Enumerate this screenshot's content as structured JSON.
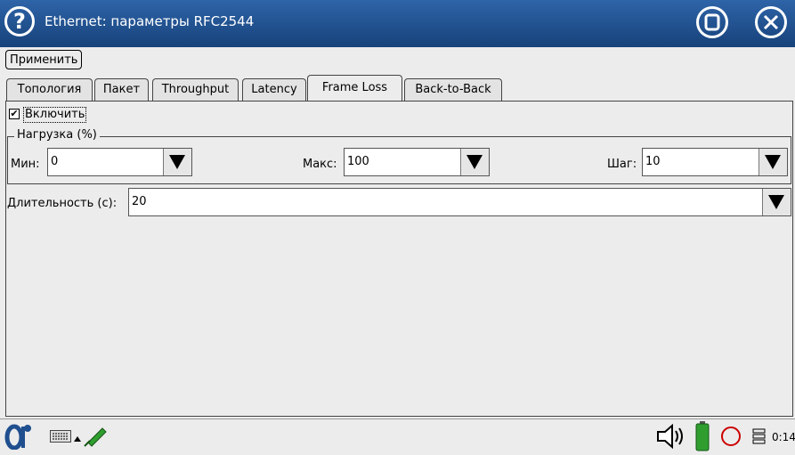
{
  "window": {
    "title": "Ethernet: параметры RFC2544",
    "help_icon": "help-icon",
    "close_icon": "close-icon",
    "minimize_icon": "window-icon"
  },
  "toolbar": {
    "apply_label": "Применить"
  },
  "tabs": [
    {
      "label": "Топология"
    },
    {
      "label": "Пакет"
    },
    {
      "label": "Throughput"
    },
    {
      "label": "Latency"
    },
    {
      "label": "Frame Loss",
      "active": true
    },
    {
      "label": "Back-to-Back"
    }
  ],
  "frame_loss": {
    "enable_label": "Включить",
    "enabled": true,
    "load_group_title": "Нагрузка (%)",
    "min_label": "Мин:",
    "min_value": "0",
    "max_label": "Макс:",
    "max_value": "100",
    "step_label": "Шаг:",
    "step_value": "10",
    "duration_label": "Длительность (с):",
    "duration_value": "20"
  },
  "taskbar": {
    "clock": "0:14",
    "colors": {
      "title_bg": "#1f4f8f",
      "battery": "#2f9e2f",
      "record": "#cc0000"
    }
  }
}
